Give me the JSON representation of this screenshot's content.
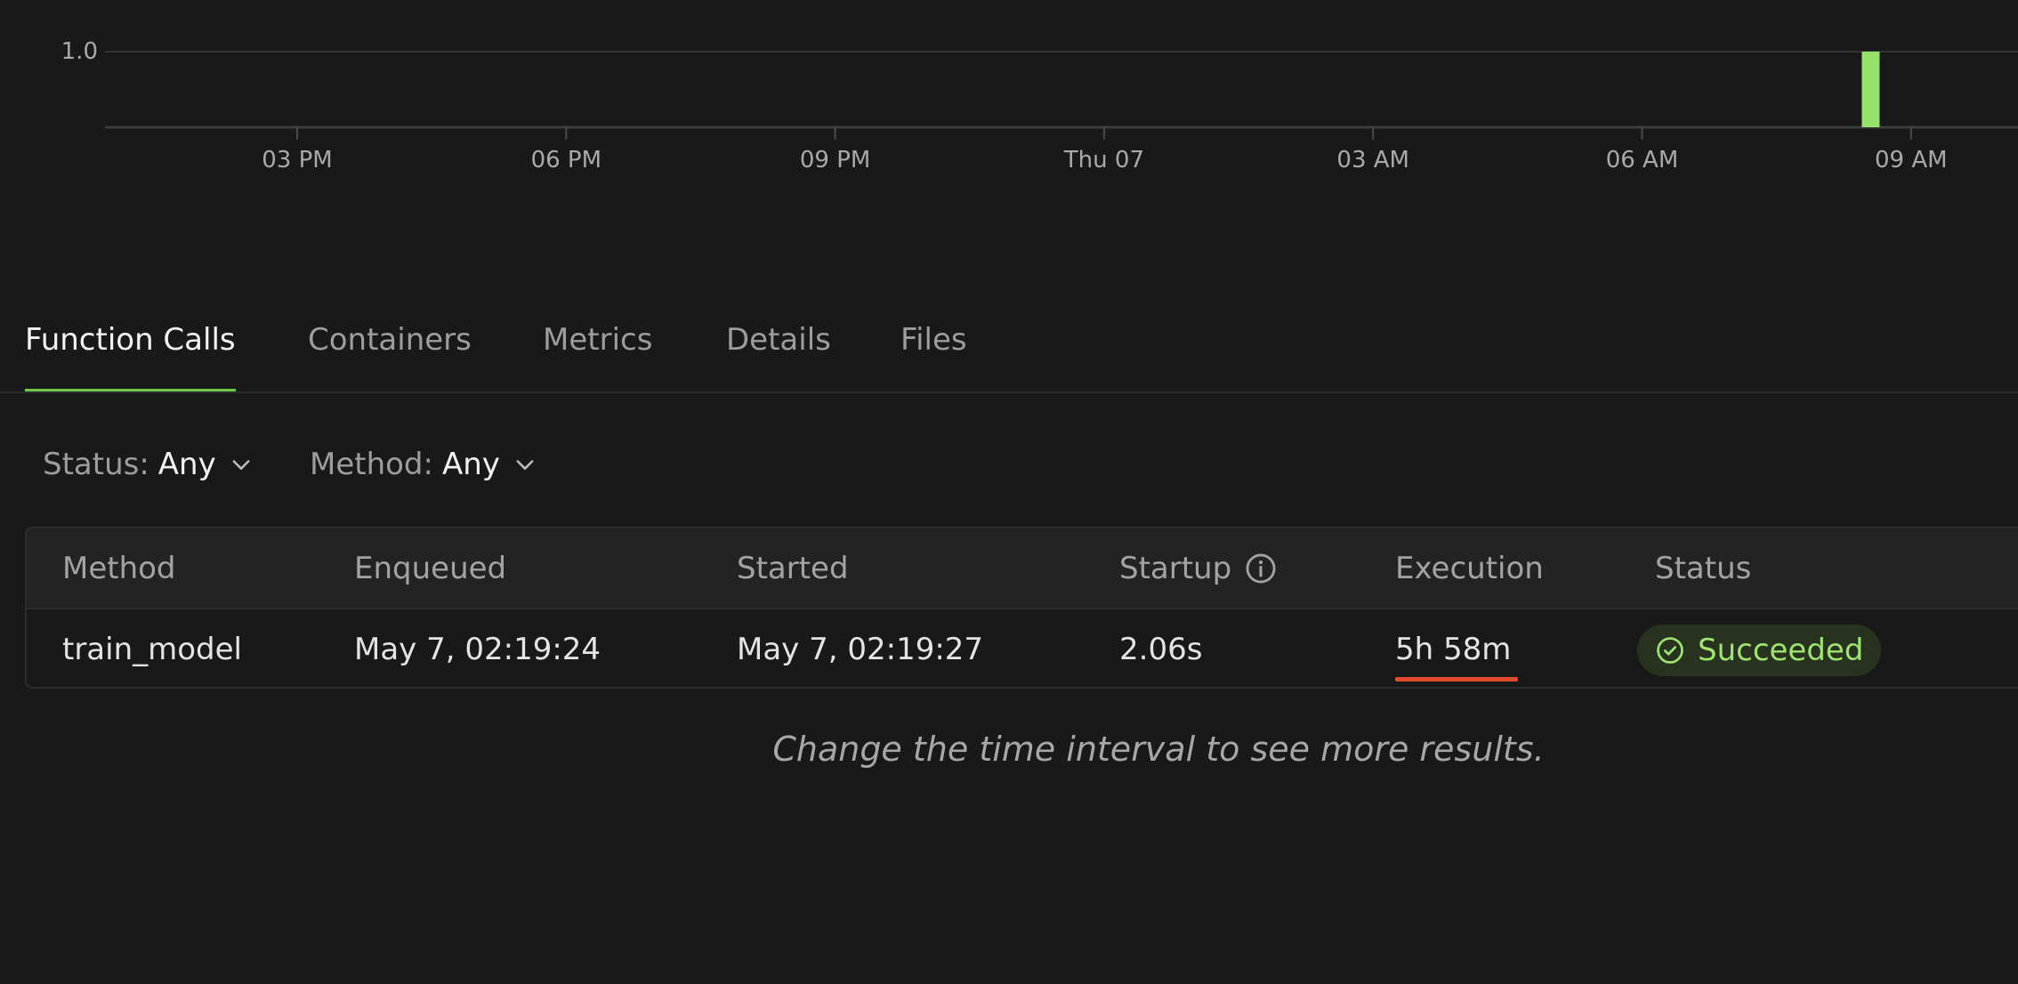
{
  "chart_data": {
    "type": "bar",
    "y_ticks": [
      "1.0"
    ],
    "x_ticks": [
      "03 PM",
      "06 PM",
      "09 PM",
      "Thu 07",
      "03 AM",
      "06 AM",
      "09 AM"
    ],
    "bars": [
      {
        "time": "Thu 07 ~08:30 AM",
        "value": 1.0
      }
    ],
    "ylim": [
      0,
      1.0
    ],
    "bar_color": "#96e16a",
    "grid": true
  },
  "tabs": [
    {
      "label": "Function Calls",
      "active": true
    },
    {
      "label": "Containers",
      "active": false
    },
    {
      "label": "Metrics",
      "active": false
    },
    {
      "label": "Details",
      "active": false
    },
    {
      "label": "Files",
      "active": false
    }
  ],
  "filters": {
    "status": {
      "label": "Status:",
      "value": "Any"
    },
    "method": {
      "label": "Method:",
      "value": "Any"
    }
  },
  "table": {
    "columns": [
      "Method",
      "Enqueued",
      "Started",
      "Startup",
      "Execution",
      "Status"
    ],
    "rows": [
      {
        "method": "train_model",
        "enqueued": "May 7, 02:19:24",
        "started": "May 7, 02:19:27",
        "startup": "2.06s",
        "execution": "5h 58m",
        "status": "Succeeded"
      }
    ]
  },
  "hint": "Change the time interval to see more results.",
  "colors": {
    "accent_green": "#6fc94a",
    "success_text": "#9fe46f",
    "execution_bar": "#e24b2c",
    "background": "#191919"
  },
  "icons": {
    "startup_info": "info-circle-icon",
    "status": "check-circle-icon",
    "filter_caret": "chevron-down-icon"
  }
}
